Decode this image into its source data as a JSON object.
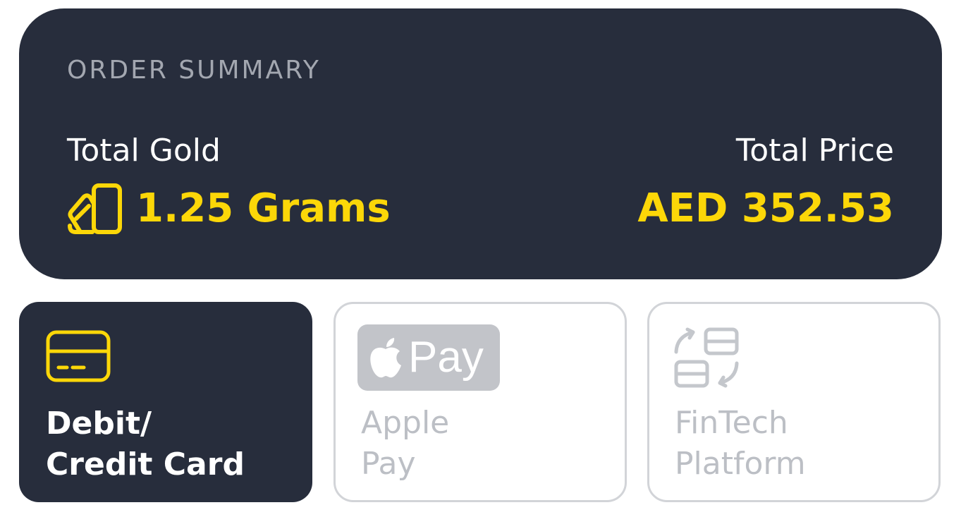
{
  "order_summary": {
    "heading": "ORDER SUMMARY",
    "total_gold_label": "Total Gold",
    "total_gold_value": "1.25 Grams",
    "total_price_label": "Total Price",
    "total_price_value": "AED 352.53",
    "icon": "gold-bars-icon"
  },
  "payment_methods": [
    {
      "id": "card",
      "label_line1": "Debit/",
      "label_line2": "Credit Card",
      "icon": "credit-card-icon",
      "selected": true
    },
    {
      "id": "apple_pay",
      "label_line1": "Apple",
      "label_line2": "Pay",
      "badge_text": "Pay",
      "icon": "apple-pay-logo",
      "selected": false
    },
    {
      "id": "fintech",
      "label_line1": "FinTech",
      "label_line2": "Platform",
      "icon": "exchange-icon",
      "selected": false
    }
  ],
  "colors": {
    "card_background": "#272d3c",
    "accent_yellow": "#fcd708",
    "muted_text": "#a3a7b0",
    "disabled_text": "#bcbfc5",
    "border_gray": "#d2d4d8"
  }
}
